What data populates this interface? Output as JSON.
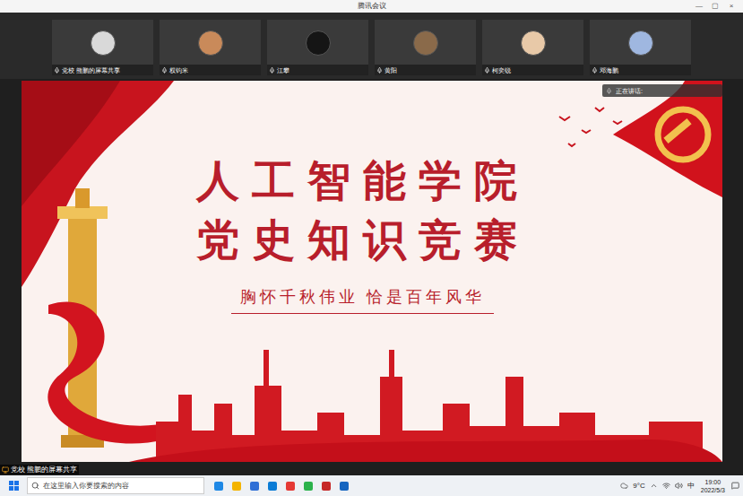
{
  "window": {
    "title": "腾讯会议",
    "controls": [
      "—",
      "▢",
      "×"
    ]
  },
  "participants": [
    {
      "name": "党校 熊鹏的屏幕共享"
    },
    {
      "name": "权钧米"
    },
    {
      "name": "江攀"
    },
    {
      "name": "黄阳"
    },
    {
      "name": "柯奕锐"
    },
    {
      "name": "邓海鹏"
    }
  ],
  "speaking": {
    "label": "正在讲话:"
  },
  "slide": {
    "title_lines": [
      "人工智能学院",
      "党史知识竞赛"
    ],
    "subtitle": "胸怀千秋伟业 恰是百年风华"
  },
  "share_label": "党校 熊鹏的屏幕共享",
  "taskbar": {
    "search_placeholder": "在这里输入你要搜索的内容",
    "weather": "9°C",
    "ime": "中",
    "time": "19:00",
    "date": "2022/5/3"
  }
}
